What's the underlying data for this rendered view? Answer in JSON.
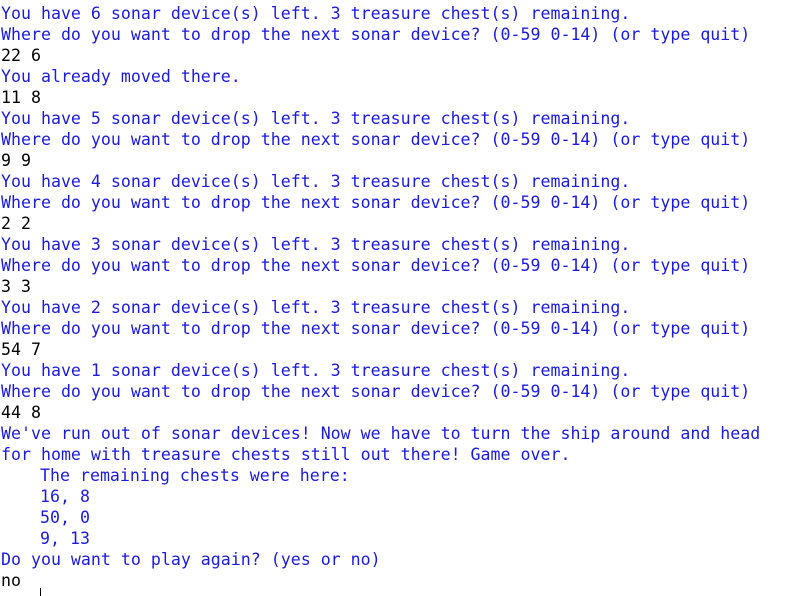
{
  "colors": {
    "output_text": "#1a1ae6",
    "input_text": "#000000",
    "background": "#ffffff"
  },
  "terminal": {
    "lines": [
      {
        "text": "You have 6 sonar device(s) left. 3 treasure chest(s) remaining.",
        "kind": "output"
      },
      {
        "text": "Where do you want to drop the next sonar device? (0-59 0-14) (or type quit)",
        "kind": "output"
      },
      {
        "text": "22 6",
        "kind": "input"
      },
      {
        "text": "You already moved there.",
        "kind": "output"
      },
      {
        "text": "11 8",
        "kind": "input"
      },
      {
        "text": "You have 5 sonar device(s) left. 3 treasure chest(s) remaining.",
        "kind": "output"
      },
      {
        "text": "Where do you want to drop the next sonar device? (0-59 0-14) (or type quit)",
        "kind": "output"
      },
      {
        "text": "9 9",
        "kind": "input"
      },
      {
        "text": "You have 4 sonar device(s) left. 3 treasure chest(s) remaining.",
        "kind": "output"
      },
      {
        "text": "Where do you want to drop the next sonar device? (0-59 0-14) (or type quit)",
        "kind": "output"
      },
      {
        "text": "2 2",
        "kind": "input"
      },
      {
        "text": "You have 3 sonar device(s) left. 3 treasure chest(s) remaining.",
        "kind": "output"
      },
      {
        "text": "Where do you want to drop the next sonar device? (0-59 0-14) (or type quit)",
        "kind": "output"
      },
      {
        "text": "3 3",
        "kind": "input"
      },
      {
        "text": "You have 2 sonar device(s) left. 3 treasure chest(s) remaining.",
        "kind": "output"
      },
      {
        "text": "Where do you want to drop the next sonar device? (0-59 0-14) (or type quit)",
        "kind": "output"
      },
      {
        "text": "54 7",
        "kind": "input"
      },
      {
        "text": "You have 1 sonar device(s) left. 3 treasure chest(s) remaining.",
        "kind": "output"
      },
      {
        "text": "Where do you want to drop the next sonar device? (0-59 0-14) (or type quit)",
        "kind": "output"
      },
      {
        "text": "44 8",
        "kind": "input"
      },
      {
        "text": "We've run out of sonar devices! Now we have to turn the ship around and head",
        "kind": "output"
      },
      {
        "text": "for home with treasure chests still out there! Game over.",
        "kind": "output"
      },
      {
        "text": "The remaining chests were here:",
        "kind": "output",
        "indent": true
      },
      {
        "text": "16, 8",
        "kind": "output",
        "indent": true
      },
      {
        "text": "50, 0",
        "kind": "output",
        "indent": true
      },
      {
        "text": "9, 13",
        "kind": "output",
        "indent": true
      },
      {
        "text": "Do you want to play again? (yes or no)",
        "kind": "output"
      },
      {
        "text": "no",
        "kind": "input"
      }
    ]
  }
}
